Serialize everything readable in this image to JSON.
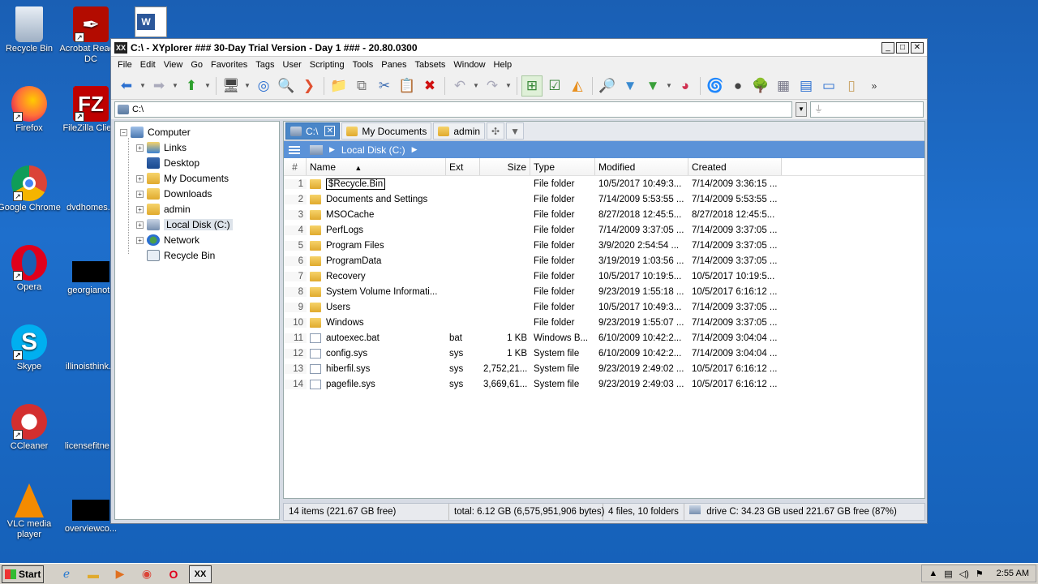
{
  "desktop": {
    "icons": [
      {
        "label": "Recycle Bin"
      },
      {
        "label": "Acrobat Reader DC"
      },
      {
        "label": "Firefox"
      },
      {
        "label": "FileZilla Client"
      },
      {
        "label": "Google Chrome"
      },
      {
        "label": "dvdhomes.p"
      },
      {
        "label": "Opera"
      },
      {
        "label": "georgianot.j"
      },
      {
        "label": "Skype"
      },
      {
        "label": "illinoisthink..."
      },
      {
        "label": "CCleaner"
      },
      {
        "label": "licensefitne..."
      },
      {
        "label": "VLC media player"
      },
      {
        "label": "overviewco..."
      }
    ]
  },
  "window": {
    "title": "C:\\ - XYplorer ### 30-Day Trial Version - Day 1 ### - 20.80.0300",
    "minimize": "_",
    "maximize": "□",
    "close": "✕"
  },
  "menu": [
    "File",
    "Edit",
    "View",
    "Go",
    "Favorites",
    "Tags",
    "User",
    "Scripting",
    "Tools",
    "Panes",
    "Tabsets",
    "Window",
    "Help"
  ],
  "address": {
    "value": "C:\\",
    "filter_placeholder": ""
  },
  "tree": {
    "items": [
      {
        "label": "Computer"
      },
      {
        "label": "Links"
      },
      {
        "label": "Desktop"
      },
      {
        "label": "My Documents"
      },
      {
        "label": "Downloads"
      },
      {
        "label": "admin"
      },
      {
        "label": "Local Disk (C:)"
      },
      {
        "label": "Network"
      },
      {
        "label": "Recycle Bin"
      }
    ]
  },
  "tabs": [
    {
      "label": "C:\\",
      "close": "✕"
    },
    {
      "label": "My Documents"
    },
    {
      "label": "admin"
    }
  ],
  "breadcrumb": {
    "label": "Local Disk (C:)"
  },
  "columns": {
    "num": "#",
    "name": "Name",
    "ext": "Ext",
    "size": "Size",
    "type": "Type",
    "modified": "Modified",
    "created": "Created"
  },
  "files": [
    {
      "num": "1",
      "name": "$Recycle.Bin",
      "ext": "",
      "size": "",
      "type": "File folder",
      "modified": "10/5/2017 10:49:3...",
      "created": "7/14/2009 3:36:15 ..."
    },
    {
      "num": "2",
      "name": "Documents and Settings",
      "ext": "",
      "size": "",
      "type": "File folder",
      "modified": "7/14/2009 5:53:55 ...",
      "created": "7/14/2009 5:53:55 ..."
    },
    {
      "num": "3",
      "name": "MSOCache",
      "ext": "",
      "size": "",
      "type": "File folder",
      "modified": "8/27/2018 12:45:5...",
      "created": "8/27/2018 12:45:5..."
    },
    {
      "num": "4",
      "name": "PerfLogs",
      "ext": "",
      "size": "",
      "type": "File folder",
      "modified": "7/14/2009 3:37:05 ...",
      "created": "7/14/2009 3:37:05 ..."
    },
    {
      "num": "5",
      "name": "Program Files",
      "ext": "",
      "size": "",
      "type": "File folder",
      "modified": "3/9/2020 2:54:54 ...",
      "created": "7/14/2009 3:37:05 ..."
    },
    {
      "num": "6",
      "name": "ProgramData",
      "ext": "",
      "size": "",
      "type": "File folder",
      "modified": "3/19/2019 1:03:56 ...",
      "created": "7/14/2009 3:37:05 ..."
    },
    {
      "num": "7",
      "name": "Recovery",
      "ext": "",
      "size": "",
      "type": "File folder",
      "modified": "10/5/2017 10:19:5...",
      "created": "10/5/2017 10:19:5..."
    },
    {
      "num": "8",
      "name": "System Volume Informati...",
      "ext": "",
      "size": "",
      "type": "File folder",
      "modified": "9/23/2019 1:55:18 ...",
      "created": "10/5/2017 6:16:12 ..."
    },
    {
      "num": "9",
      "name": "Users",
      "ext": "",
      "size": "",
      "type": "File folder",
      "modified": "10/5/2017 10:49:3...",
      "created": "7/14/2009 3:37:05 ..."
    },
    {
      "num": "10",
      "name": "Windows",
      "ext": "",
      "size": "",
      "type": "File folder",
      "modified": "9/23/2019 1:55:07 ...",
      "created": "7/14/2009 3:37:05 ..."
    },
    {
      "num": "11",
      "name": "autoexec.bat",
      "ext": "bat",
      "size": "1 KB",
      "type": "Windows B...",
      "modified": "6/10/2009 10:42:2...",
      "created": "7/14/2009 3:04:04 ..."
    },
    {
      "num": "12",
      "name": "config.sys",
      "ext": "sys",
      "size": "1 KB",
      "type": "System file",
      "modified": "6/10/2009 10:42:2...",
      "created": "7/14/2009 3:04:04 ..."
    },
    {
      "num": "13",
      "name": "hiberfil.sys",
      "ext": "sys",
      "size": "2,752,21...",
      "type": "System file",
      "modified": "9/23/2019 2:49:02 ...",
      "created": "10/5/2017 6:16:12 ..."
    },
    {
      "num": "14",
      "name": "pagefile.sys",
      "ext": "sys",
      "size": "3,669,61...",
      "type": "System file",
      "modified": "9/23/2019 2:49:03 ...",
      "created": "10/5/2017 6:16:12 ..."
    }
  ],
  "status": {
    "items": "14 items (221.67 GB free)",
    "total": "total: 6.12 GB (6,575,951,906 bytes)",
    "counts": "4 files, 10 folders",
    "drive": "drive C:  34.23 GB used   221.67 GB free (87%)"
  },
  "taskbar": {
    "start": "Start",
    "time": "2:55 AM"
  },
  "colors": {
    "accent": "#5b92d8",
    "desktop": "#1a5fb4"
  }
}
